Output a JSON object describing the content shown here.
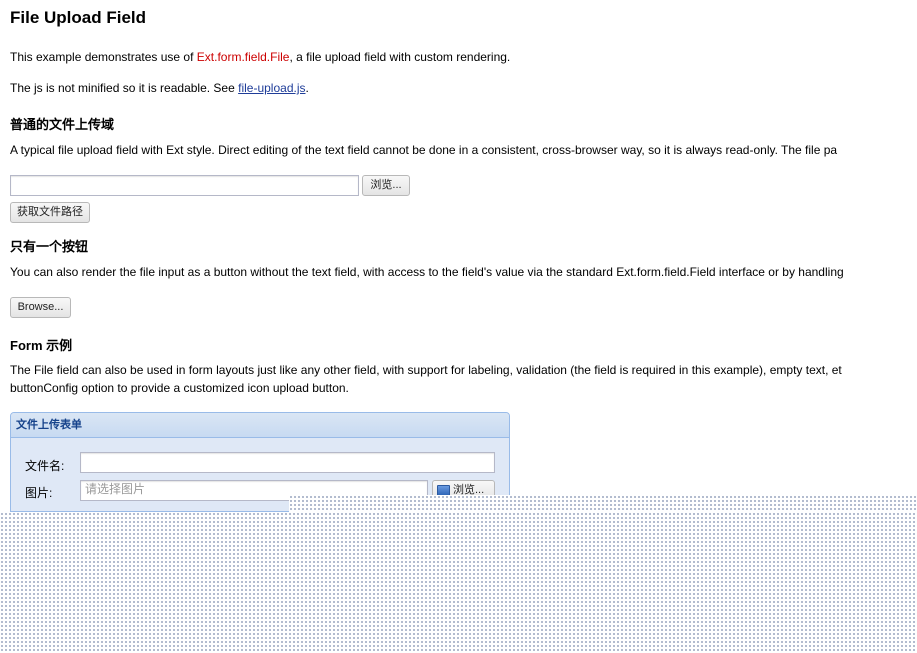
{
  "page": {
    "title": "File Upload Field",
    "intro_prefix": "This example demonstrates use of ",
    "intro_highlight": "Ext.form.field.File",
    "intro_suffix": ", a file upload field with custom rendering.",
    "js_note_prefix": "The js is not minified so it is readable. See ",
    "js_link": "file-upload.js",
    "js_note_suffix": "."
  },
  "section1": {
    "heading": "普通的文件上传域",
    "desc": "A typical file upload field with Ext style. Direct editing of the text field cannot be done in a consistent, cross-browser way, so it is always read-only. The file pa",
    "browse_label": "浏览...",
    "get_path_label": "获取文件路径"
  },
  "section2": {
    "heading": "只有一个按钮",
    "desc": "You can also render the file input as a button without the text field, with access to the field's value via the standard Ext.form.field.Field interface or by handling",
    "button_label": "Browse..."
  },
  "section3": {
    "heading": "Form 示例",
    "desc_line1": "The File field can also be used in form layouts just like any other field, with support for labeling, validation (the field is required in this example), empty text, et",
    "desc_line2": "buttonConfig option to provide a customized icon upload button."
  },
  "form_panel": {
    "title": "文件上传表单",
    "filename_label": "文件名:",
    "filename_value": "",
    "image_label": "图片:",
    "image_placeholder": "请选择图片",
    "image_browse_label": "浏览..."
  },
  "colors": {
    "highlight": "#cc0000",
    "link": "#1f3d99",
    "panel_border": "#99bbe8",
    "panel_title": "#15428b"
  }
}
